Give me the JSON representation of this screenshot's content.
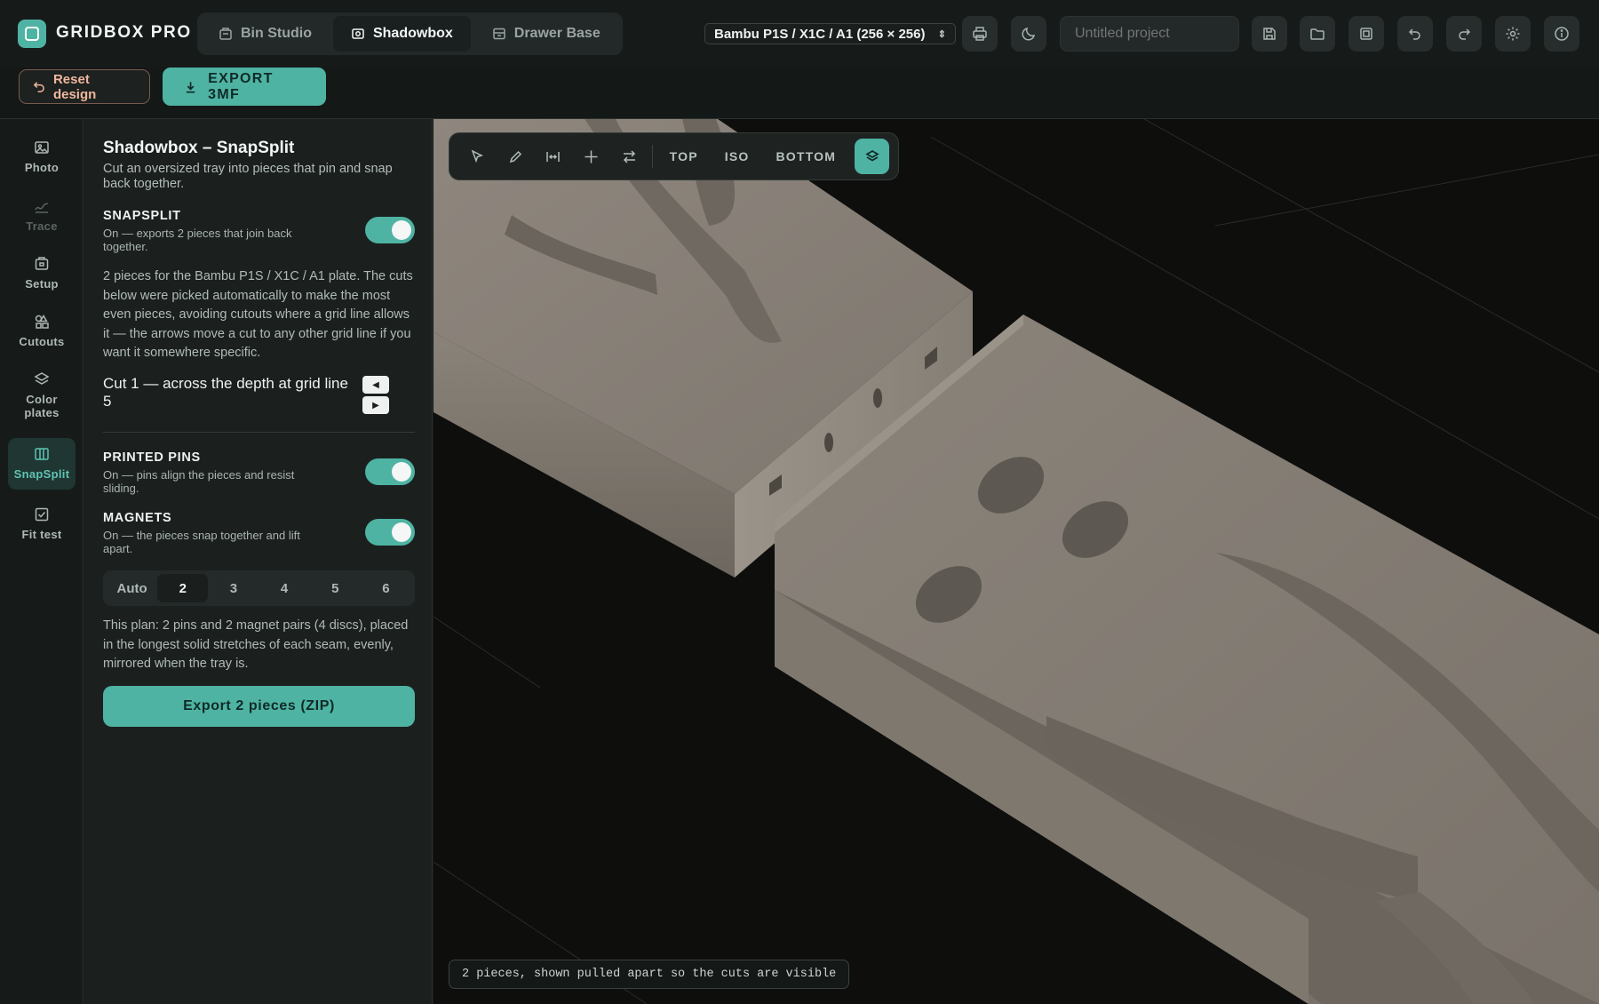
{
  "app": {
    "brand": "GRIDBOX PRO",
    "accent_color": "#4fb3a3"
  },
  "mode_tabs": [
    {
      "label": "Bin Studio",
      "icon": "bin-icon",
      "active": false
    },
    {
      "label": "Shadowbox",
      "icon": "shadowbox-icon",
      "active": true
    },
    {
      "label": "Drawer Base",
      "icon": "drawer-icon",
      "active": false
    }
  ],
  "printer": {
    "selected": "Bambu P1S / X1C / A1 (256 × 256)"
  },
  "project": {
    "name_placeholder": "Untitled project"
  },
  "toolbar_icons": [
    "printer-icon",
    "moon-icon",
    "save-icon",
    "folder-icon",
    "library-icon",
    "undo-icon",
    "redo-icon",
    "settings-icon",
    "info-icon"
  ],
  "actions": {
    "reset_label": "Reset design",
    "export_label": "EXPORT 3MF"
  },
  "rail": [
    {
      "label": "Photo",
      "icon": "photo-icon",
      "state": "normal"
    },
    {
      "label": "Trace",
      "icon": "trace-icon",
      "state": "disabled"
    },
    {
      "label": "Setup",
      "icon": "setup-icon",
      "state": "normal"
    },
    {
      "label": "Cutouts",
      "icon": "cutouts-icon",
      "state": "normal"
    },
    {
      "label": "Color plates",
      "icon": "layers-icon",
      "state": "normal"
    },
    {
      "label": "SnapSplit",
      "icon": "snapsplit-icon",
      "state": "active"
    },
    {
      "label": "Fit test",
      "icon": "fit-test-icon",
      "state": "normal"
    }
  ],
  "panel": {
    "title": "Shadowbox – SnapSplit",
    "subtitle": "Cut an oversized tray into pieces that pin and snap back together.",
    "snapsplit": {
      "heading": "SNAPSPLIT",
      "desc": "On — exports 2 pieces that join back together.",
      "on": true
    },
    "info": "2 pieces for the Bambu P1S / X1C / A1 plate. The cuts below were picked automatically to make the most even pieces, avoiding cutouts where a grid line allows it — the arrows move a cut to any other grid line if you want it somewhere specific.",
    "cut": {
      "label": "Cut 1 — across the depth at grid line 5",
      "prev": "◀",
      "next": "▶"
    },
    "pins": {
      "heading": "PRINTED PINS",
      "desc": "On — pins align the pieces and resist sliding.",
      "on": true
    },
    "magnets": {
      "heading": "MAGNETS",
      "desc": "On — the pieces snap together and lift apart.",
      "on": true
    },
    "counts": [
      "Auto",
      "2",
      "3",
      "4",
      "5",
      "6"
    ],
    "count_selected": "2",
    "plan": "This plan: 2 pins and 2 magnet pairs (4 discs), placed in the longest solid stretches of each seam, evenly, mirrored when the tray is.",
    "export_zip_label": "Export 2 pieces (ZIP)"
  },
  "viewport": {
    "tools": [
      "select-icon",
      "pen-icon",
      "measure-icon",
      "crosshair-icon",
      "swap-icon"
    ],
    "views": [
      "TOP",
      "ISO",
      "BOTTOM"
    ],
    "caption": "2 pieces, shown pulled apart so the cuts are visible"
  }
}
